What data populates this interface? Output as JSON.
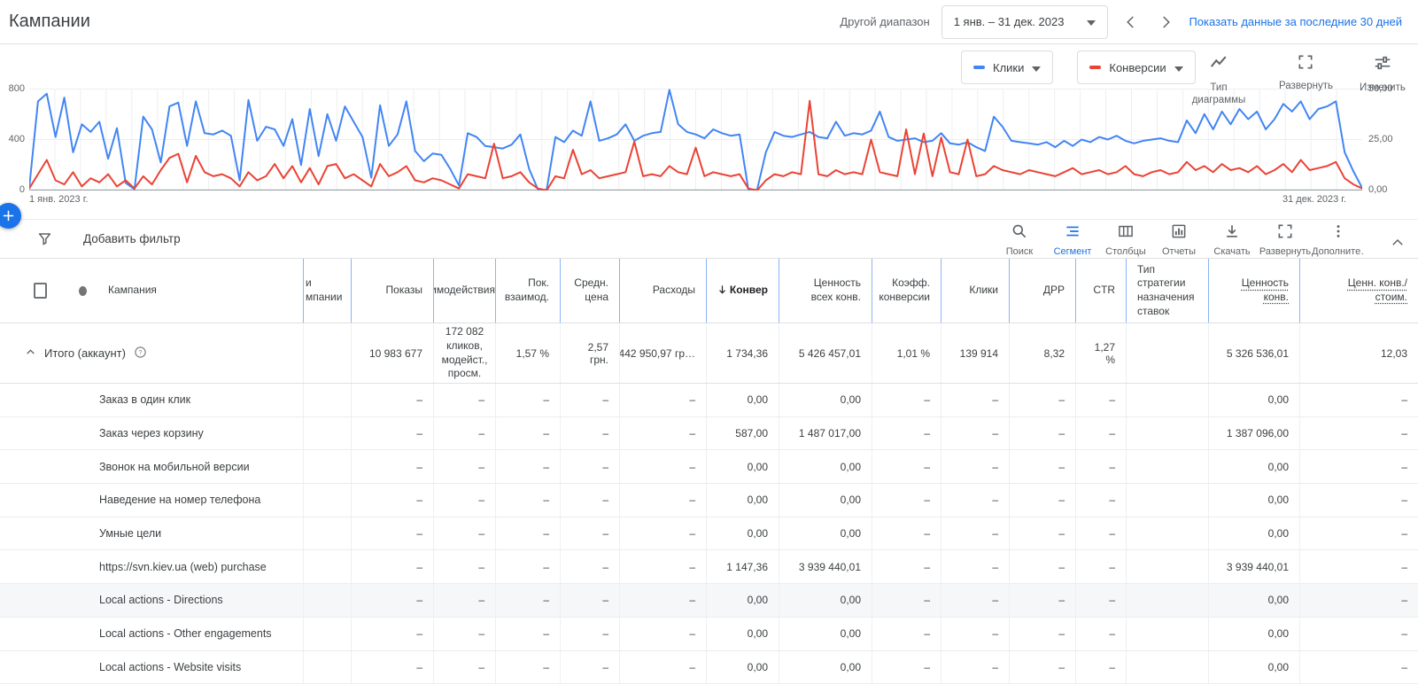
{
  "header": {
    "title": "Кампании",
    "range_label": "Другой диапазон",
    "date_picker": {
      "value": "1 янв. – 31 дек. 2023",
      "caret_icon": "caret-down-icon"
    },
    "prev_icon": "chevron-left-icon",
    "next_icon": "chevron-right-icon",
    "last30_link": "Показать данные за последние 30 дней"
  },
  "fab": {
    "icon": "plus-icon",
    "color": "#1a73e8"
  },
  "chart": {
    "legend": [
      {
        "label": "Клики",
        "swatch": "#4285f4",
        "caret_icon": "caret-down-icon"
      },
      {
        "label": "Конверсии",
        "swatch": "#ea4335",
        "caret_icon": "caret-down-icon"
      }
    ],
    "tools": [
      {
        "icon": "chart-type-icon",
        "label": "Тип диаграммы"
      },
      {
        "icon": "expand-icon",
        "label": "Развернуть"
      },
      {
        "icon": "tune-icon",
        "label": "Изменить"
      }
    ]
  },
  "chart_data": {
    "type": "line",
    "grid": true,
    "legend_position": "top-right",
    "x_tick_labels": [
      "1 янв. 2023 г.",
      "31 дек. 2023 г."
    ],
    "left_axis": {
      "name": "Клики",
      "max": 800,
      "ticks": [
        0,
        400,
        800
      ],
      "display_labels": [
        "800",
        "400",
        "0"
      ]
    },
    "right_axis": {
      "name": "Конверсии",
      "max": 50,
      "ticks": [
        "0,00",
        "25,00",
        "50,00"
      ],
      "display_labels": [
        "50,00",
        "25,00",
        "0,00"
      ]
    },
    "series": [
      {
        "name": "Клики",
        "color": "#4285f4",
        "axis": "left",
        "values": [
          20,
          700,
          760,
          420,
          730,
          300,
          520,
          460,
          540,
          250,
          490,
          60,
          10,
          580,
          480,
          220,
          660,
          690,
          350,
          700,
          450,
          440,
          470,
          430,
          80,
          710,
          390,
          500,
          480,
          350,
          560,
          200,
          640,
          270,
          600,
          390,
          660,
          540,
          420,
          100,
          670,
          350,
          440,
          700,
          310,
          230,
          290,
          280,
          170,
          40,
          450,
          420,
          350,
          340,
          330,
          360,
          440,
          170,
          10,
          5,
          420,
          380,
          470,
          430,
          700,
          390,
          410,
          440,
          520,
          390,
          430,
          450,
          460,
          790,
          520,
          460,
          440,
          410,
          480,
          450,
          430,
          440,
          10,
          5,
          300,
          460,
          430,
          420,
          440,
          460,
          420,
          410,
          540,
          430,
          450,
          440,
          470,
          620,
          420,
          390,
          400,
          410,
          380,
          390,
          450,
          370,
          360,
          380,
          340,
          310,
          580,
          500,
          390,
          380,
          370,
          360,
          380,
          340,
          390,
          350,
          400,
          380,
          420,
          400,
          430,
          390,
          370,
          390,
          400,
          410,
          390,
          380,
          550,
          450,
          600,
          480,
          620,
          520,
          640,
          560,
          620,
          480,
          560,
          680,
          620,
          700,
          560,
          640,
          660,
          700,
          300,
          150,
          20
        ]
      },
      {
        "name": "Конверсии",
        "color": "#ea4335",
        "axis": "right",
        "values": [
          1,
          8,
          15,
          5,
          3,
          9,
          2,
          6,
          4,
          8,
          2,
          5,
          1,
          7,
          3,
          10,
          16,
          18,
          4,
          17,
          9,
          7,
          8,
          6,
          2,
          9,
          5,
          7,
          13,
          6,
          12,
          4,
          11,
          3,
          12,
          13,
          6,
          8,
          5,
          2,
          13,
          7,
          9,
          12,
          5,
          4,
          6,
          5,
          3,
          1,
          8,
          7,
          6,
          23,
          6,
          7,
          9,
          4,
          1,
          0,
          7,
          6,
          20,
          8,
          10,
          6,
          7,
          8,
          9,
          24,
          7,
          8,
          7,
          12,
          9,
          8,
          21,
          7,
          9,
          8,
          7,
          8,
          1,
          0,
          5,
          8,
          7,
          9,
          8,
          44,
          8,
          7,
          10,
          8,
          9,
          8,
          25,
          9,
          8,
          7,
          30,
          8,
          28,
          7,
          26,
          9,
          8,
          25,
          7,
          8,
          12,
          10,
          9,
          8,
          10,
          9,
          8,
          7,
          9,
          11,
          8,
          9,
          10,
          8,
          9,
          12,
          8,
          7,
          9,
          10,
          8,
          9,
          14,
          10,
          12,
          9,
          13,
          10,
          11,
          9,
          12,
          8,
          10,
          13,
          9,
          15,
          10,
          11,
          12,
          14,
          6,
          3,
          1
        ]
      }
    ]
  },
  "toolbar": {
    "filter_icon": "filter-icon",
    "filter_label": "Добавить фильтр",
    "buttons": [
      {
        "icon": "search-icon",
        "label": "Поиск",
        "active": false
      },
      {
        "icon": "segment-icon",
        "label": "Сегмент",
        "active": true
      },
      {
        "icon": "columns-icon",
        "label": "Столбцы",
        "active": false
      },
      {
        "icon": "reports-icon",
        "label": "Отчеты",
        "active": false
      },
      {
        "icon": "download-icon",
        "label": "Скачать",
        "active": false
      },
      {
        "icon": "expand-icon",
        "label": "Развернуть",
        "active": false
      },
      {
        "icon": "more-vert-icon",
        "label": "Дополните…",
        "active": false
      }
    ],
    "collapse_icon": "chevron-up-icon"
  },
  "table": {
    "columns": [
      {
        "key": "select",
        "type": "checkbox"
      },
      {
        "key": "status",
        "type": "dot"
      },
      {
        "key": "name",
        "label": "Кампания",
        "align": "l"
      },
      {
        "key": "clipped",
        "label": "и\nмпании",
        "align": "l",
        "clip": true
      },
      {
        "key": "impressions",
        "label": "Показы",
        "align": "r"
      },
      {
        "key": "interactions",
        "label": "Взаимодействия",
        "align": "r",
        "hclip": true
      },
      {
        "key": "interaction_rate",
        "label": "Пок. взаимод.",
        "align": "r"
      },
      {
        "key": "avg_cost",
        "label": "Средн. цена",
        "align": "r"
      },
      {
        "key": "cost",
        "label": "Расходы",
        "align": "r"
      },
      {
        "key": "conversions",
        "label": "Конвер",
        "align": "r",
        "sorted": true,
        "sort_icon": "arrow-down-icon"
      },
      {
        "key": "conv_value",
        "label": "Ценность всех конв.",
        "align": "r"
      },
      {
        "key": "conv_rate",
        "label": "Коэфф. конверсии",
        "align": "r"
      },
      {
        "key": "clicks",
        "label": "Клики",
        "align": "r"
      },
      {
        "key": "drr",
        "label": "ДРР",
        "align": "r"
      },
      {
        "key": "ctr",
        "label": "CTR",
        "align": "r"
      },
      {
        "key": "bid_strategy",
        "label": "Тип стратегии назначения ставок",
        "align": "l"
      },
      {
        "key": "value_conv",
        "label": "Ценность\nконв.",
        "align": "r",
        "dotted": true
      },
      {
        "key": "value_per_cost",
        "label": "Ценн. конв./\nстоим.",
        "align": "r",
        "dotted": true
      }
    ],
    "total_row": {
      "collapse_icon": "chevron-up-small-icon",
      "help_icon": "help-icon",
      "name": "Итого (аккаунт)",
      "clipped": "",
      "impressions": "10 983 677",
      "interactions": "172 082 кликов, модейст., просм.",
      "interaction_rate": "1,57 %",
      "avg_cost": "2,57 грн.",
      "cost": "442 950,97 гр…",
      "conversions": "1 734,36",
      "conv_value": "5 426 457,01",
      "conv_rate": "1,01 %",
      "clicks": "139 914",
      "drr": "8,32",
      "ctr": "1,27 %",
      "bid_strategy": "",
      "value_conv": "5 326 536,01",
      "value_per_cost": "12,03"
    },
    "rows": [
      {
        "name": "Заказ в один клик",
        "clipped": "",
        "impressions": "–",
        "interactions": "–",
        "interaction_rate": "–",
        "avg_cost": "–",
        "cost": "–",
        "conversions": "0,00",
        "conv_value": "0,00",
        "conv_rate": "–",
        "clicks": "–",
        "drr": "–",
        "ctr": "–",
        "bid_strategy": "",
        "value_conv": "0,00",
        "value_per_cost": "–",
        "highlight": false
      },
      {
        "name": "Заказ через корзину",
        "clipped": "",
        "impressions": "–",
        "interactions": "–",
        "interaction_rate": "–",
        "avg_cost": "–",
        "cost": "–",
        "conversions": "587,00",
        "conv_value": "1 487 017,00",
        "conv_rate": "–",
        "clicks": "–",
        "drr": "–",
        "ctr": "–",
        "bid_strategy": "",
        "value_conv": "1 387 096,00",
        "value_per_cost": "–",
        "highlight": false
      },
      {
        "name": "Звонок на мобильной версии",
        "clipped": "",
        "impressions": "–",
        "interactions": "–",
        "interaction_rate": "–",
        "avg_cost": "–",
        "cost": "–",
        "conversions": "0,00",
        "conv_value": "0,00",
        "conv_rate": "–",
        "clicks": "–",
        "drr": "–",
        "ctr": "–",
        "bid_strategy": "",
        "value_conv": "0,00",
        "value_per_cost": "–",
        "highlight": false
      },
      {
        "name": "Наведение на номер телефона",
        "clipped": "",
        "impressions": "–",
        "interactions": "–",
        "interaction_rate": "–",
        "avg_cost": "–",
        "cost": "–",
        "conversions": "0,00",
        "conv_value": "0,00",
        "conv_rate": "–",
        "clicks": "–",
        "drr": "–",
        "ctr": "–",
        "bid_strategy": "",
        "value_conv": "0,00",
        "value_per_cost": "–",
        "highlight": false
      },
      {
        "name": "Умные цели",
        "clipped": "",
        "impressions": "–",
        "interactions": "–",
        "interaction_rate": "–",
        "avg_cost": "–",
        "cost": "–",
        "conversions": "0,00",
        "conv_value": "0,00",
        "conv_rate": "–",
        "clicks": "–",
        "drr": "–",
        "ctr": "–",
        "bid_strategy": "",
        "value_conv": "0,00",
        "value_per_cost": "–",
        "highlight": false
      },
      {
        "name": "https://svn.kiev.ua (web) purchase",
        "clipped": "",
        "impressions": "–",
        "interactions": "–",
        "interaction_rate": "–",
        "avg_cost": "–",
        "cost": "–",
        "conversions": "1 147,36",
        "conv_value": "3 939 440,01",
        "conv_rate": "–",
        "clicks": "–",
        "drr": "–",
        "ctr": "–",
        "bid_strategy": "",
        "value_conv": "3 939 440,01",
        "value_per_cost": "–",
        "highlight": false
      },
      {
        "name": "Local actions - Directions",
        "clipped": "",
        "impressions": "–",
        "interactions": "–",
        "interaction_rate": "–",
        "avg_cost": "–",
        "cost": "–",
        "conversions": "0,00",
        "conv_value": "0,00",
        "conv_rate": "–",
        "clicks": "–",
        "drr": "–",
        "ctr": "–",
        "bid_strategy": "",
        "value_conv": "0,00",
        "value_per_cost": "–",
        "highlight": true
      },
      {
        "name": "Local actions - Other engagements",
        "clipped": "",
        "impressions": "–",
        "interactions": "–",
        "interaction_rate": "–",
        "avg_cost": "–",
        "cost": "–",
        "conversions": "0,00",
        "conv_value": "0,00",
        "conv_rate": "–",
        "clicks": "–",
        "drr": "–",
        "ctr": "–",
        "bid_strategy": "",
        "value_conv": "0,00",
        "value_per_cost": "–",
        "highlight": false
      },
      {
        "name": "Local actions - Website visits",
        "clipped": "",
        "impressions": "–",
        "interactions": "–",
        "interaction_rate": "–",
        "avg_cost": "–",
        "cost": "–",
        "conversions": "0,00",
        "conv_value": "0,00",
        "conv_rate": "–",
        "clicks": "–",
        "drr": "–",
        "ctr": "–",
        "bid_strategy": "",
        "value_conv": "0,00",
        "value_per_cost": "–",
        "highlight": false
      }
    ]
  }
}
